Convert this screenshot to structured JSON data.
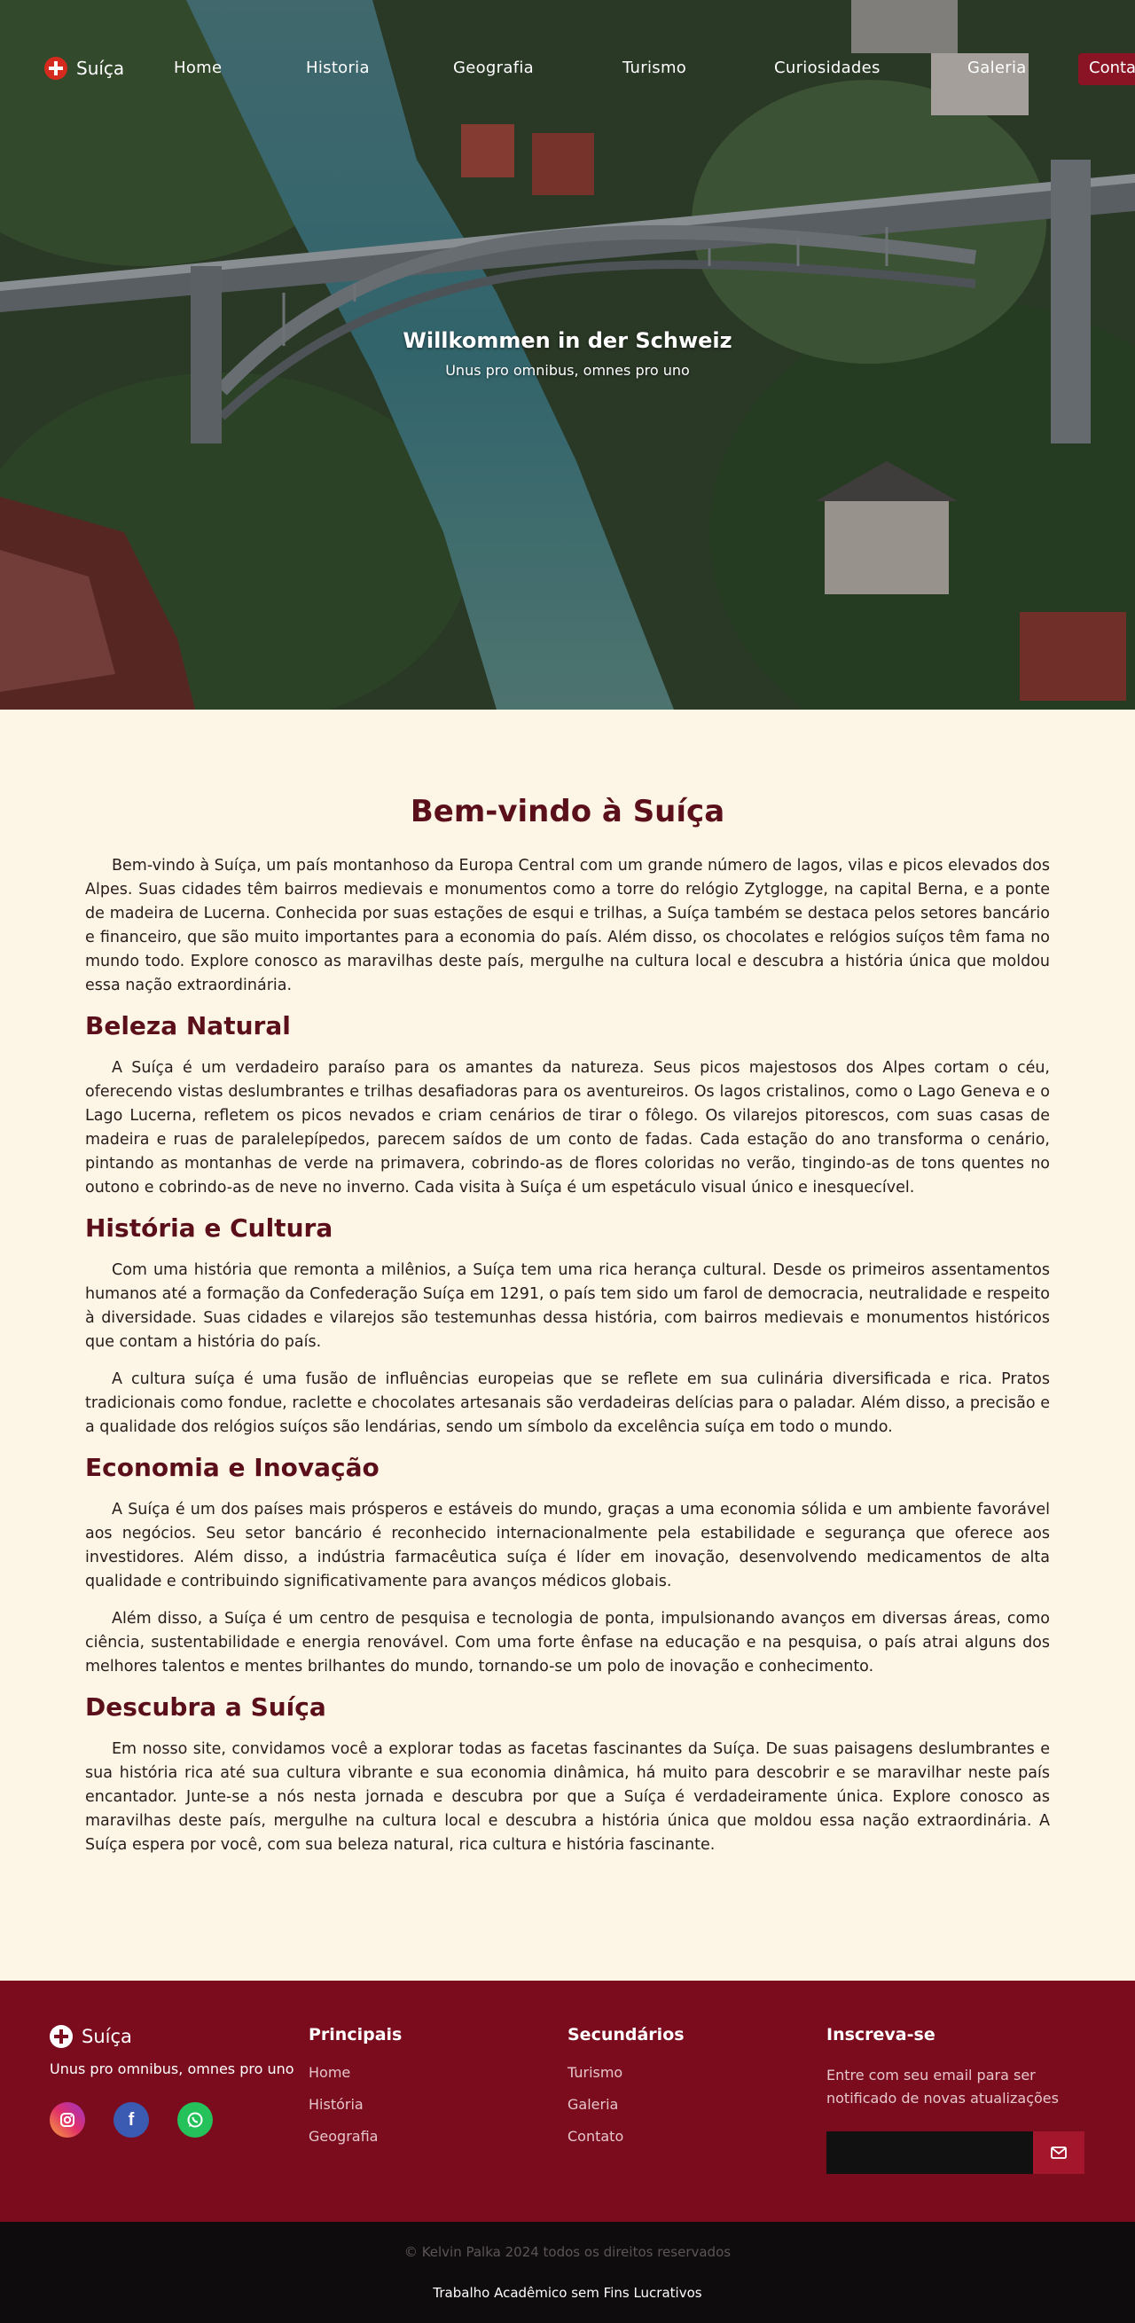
{
  "nav": {
    "brand": "Suíça",
    "items": [
      {
        "label": "Home"
      },
      {
        "label": "Historia"
      },
      {
        "label": "Geografia"
      },
      {
        "label": "Turismo"
      },
      {
        "label": "Curiosidades"
      },
      {
        "label": "Galeria"
      }
    ],
    "cta": "Conta"
  },
  "hero": {
    "title": "Willkommen in der Schweiz",
    "subtitle": "Unus pro omnibus, omnes pro uno"
  },
  "main": {
    "title": "Bem-vindo à Suíça",
    "intro": "Bem-vindo à Suíça, um país montanhoso da Europa Central com um grande número de lagos, vilas e picos elevados dos Alpes. Suas cidades têm bairros medievais e monumentos como a torre do relógio Zytglogge, na capital Berna, e a ponte de madeira de Lucerna. Conhecida por suas estações de esqui e trilhas, a Suíça também se destaca pelos setores bancário e financeiro, que são muito importantes para a economia do país. Além disso, os chocolates e relógios suíços têm fama no mundo todo. Explore conosco as maravilhas deste país, mergulhe na cultura local e descubra a história única que moldou essa nação extraordinária.",
    "sections": [
      {
        "heading": "Beleza Natural",
        "paragraphs": [
          "A Suíça é um verdadeiro paraíso para os amantes da natureza. Seus picos majestosos dos Alpes cortam o céu, oferecendo vistas deslumbrantes e trilhas desafiadoras para os aventureiros. Os lagos cristalinos, como o Lago Geneva e o Lago Lucerna, refletem os picos nevados e criam cenários de tirar o fôlego. Os vilarejos pitorescos, com suas casas de madeira e ruas de paralelepípedos, parecem saídos de um conto de fadas. Cada estação do ano transforma o cenário, pintando as montanhas de verde na primavera, cobrindo-as de flores coloridas no verão, tingindo-as de tons quentes no outono e cobrindo-as de neve no inverno. Cada visita à Suíça é um espetáculo visual único e inesquecível."
        ]
      },
      {
        "heading": "História e Cultura",
        "paragraphs": [
          "Com uma história que remonta a milênios, a Suíça tem uma rica herança cultural. Desde os primeiros assentamentos humanos até a formação da Confederação Suíça em 1291, o país tem sido um farol de democracia, neutralidade e respeito à diversidade. Suas cidades e vilarejos são testemunhas dessa história, com bairros medievais e monumentos históricos que contam a história do país.",
          "A cultura suíça é uma fusão de influências europeias que se reflete em sua culinária diversificada e rica. Pratos tradicionais como fondue, raclette e chocolates artesanais são verdadeiras delícias para o paladar. Além disso, a precisão e a qualidade dos relógios suíços são lendárias, sendo um símbolo da excelência suíça em todo o mundo."
        ]
      },
      {
        "heading": "Economia e Inovação",
        "paragraphs": [
          "A Suíça é um dos países mais prósperos e estáveis do mundo, graças a uma economia sólida e um ambiente favorável aos negócios. Seu setor bancário é reconhecido internacionalmente pela estabilidade e segurança que oferece aos investidores. Além disso, a indústria farmacêutica suíça é líder em inovação, desenvolvendo medicamentos de alta qualidade e contribuindo significativamente para avanços médicos globais.",
          "Além disso, a Suíça é um centro de pesquisa e tecnologia de ponta, impulsionando avanços em diversas áreas, como ciência, sustentabilidade e energia renovável. Com uma forte ênfase na educação e na pesquisa, o país atrai alguns dos melhores talentos e mentes brilhantes do mundo, tornando-se um polo de inovação e conhecimento."
        ]
      },
      {
        "heading": "Descubra a Suíça",
        "paragraphs": [
          "Em nosso site, convidamos você a explorar todas as facetas fascinantes da Suíça. De suas paisagens deslumbrantes e sua história rica até sua cultura vibrante e sua economia dinâmica, há muito para descobrir e se maravilhar neste país encantador. Junte-se a nós nesta jornada e descubra por que a Suíça é verdadeiramente única. Explore conosco as maravilhas deste país, mergulhe na cultura local e descubra a história única que moldou essa nação extraordinária. A Suíça espera por você, com sua beleza natural, rica cultura e história fascinante."
        ]
      }
    ]
  },
  "footer": {
    "brand": "Suíça",
    "tagline": "Unus pro omnibus, omnes pro uno",
    "socials": [
      "instagram-icon",
      "facebook-icon",
      "whatsapp-icon"
    ],
    "principais": {
      "heading": "Principais",
      "links": [
        "Home",
        "História",
        "Geografia"
      ]
    },
    "secundarios": {
      "heading": "Secundários",
      "links": [
        "Turismo",
        "Galeria",
        "Contato"
      ]
    },
    "newsletter": {
      "heading": "Inscreva-se",
      "description": "Entre com seu email para ser notificado de novas atualizações",
      "email_value": "",
      "email_placeholder": ""
    }
  },
  "bottom": {
    "copyright": "© Kelvin Palka 2024 todos os direitos reservados",
    "note": "Trabalho Acadêmico sem Fins Lucrativos"
  },
  "colors": {
    "accent": "#5a0f1b",
    "footer_bg": "#7a0c1e",
    "page_bg": "#fdf6e6",
    "bottom_bg": "#0e0c0d"
  }
}
